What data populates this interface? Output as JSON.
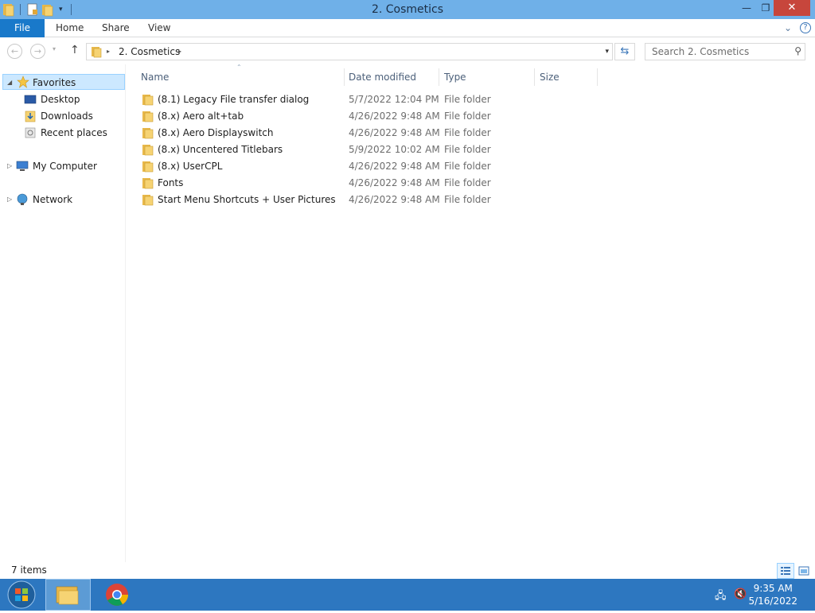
{
  "window": {
    "title": "2. Cosmetics",
    "minimize_glyph": "—",
    "restore_glyph": "❐",
    "close_glyph": "✕"
  },
  "ribbon": {
    "file_label": "File",
    "tabs": [
      {
        "label": "Home"
      },
      {
        "label": "Share"
      },
      {
        "label": "View"
      }
    ]
  },
  "address": {
    "crumb": "2. Cosmetics",
    "search_placeholder": "Search 2. Cosmetics"
  },
  "nav_pane": {
    "favorites": "Favorites",
    "desktop": "Desktop",
    "downloads": "Downloads",
    "recent": "Recent places",
    "computer": "My Computer",
    "network": "Network"
  },
  "columns": {
    "name": "Name",
    "date": "Date modified",
    "type": "Type",
    "size": "Size"
  },
  "files": [
    {
      "name": "(8.1) Legacy File transfer dialog",
      "date": "5/7/2022 12:04 PM",
      "type": "File folder"
    },
    {
      "name": "(8.x) Aero alt+tab",
      "date": "4/26/2022 9:48 AM",
      "type": "File folder"
    },
    {
      "name": "(8.x) Aero Displayswitch",
      "date": "4/26/2022 9:48 AM",
      "type": "File folder"
    },
    {
      "name": "(8.x) Uncentered Titlebars",
      "date": "5/9/2022 10:02 AM",
      "type": "File folder"
    },
    {
      "name": "(8.x) UserCPL",
      "date": "4/26/2022 9:48 AM",
      "type": "File folder"
    },
    {
      "name": "Fonts",
      "date": "4/26/2022 9:48 AM",
      "type": "File folder"
    },
    {
      "name": "Start Menu Shortcuts + User Pictures",
      "date": "4/26/2022 9:48 AM",
      "type": "File folder"
    }
  ],
  "status": {
    "item_count": "7 items"
  },
  "taskbar": {
    "time": "9:35 AM",
    "date": "5/16/2022"
  },
  "colors": {
    "titlebar": "#6fb0e8",
    "file_tab": "#1979ca",
    "close_button": "#c7463c",
    "taskbar": "#2d77c0",
    "selection": "#cce8ff"
  }
}
